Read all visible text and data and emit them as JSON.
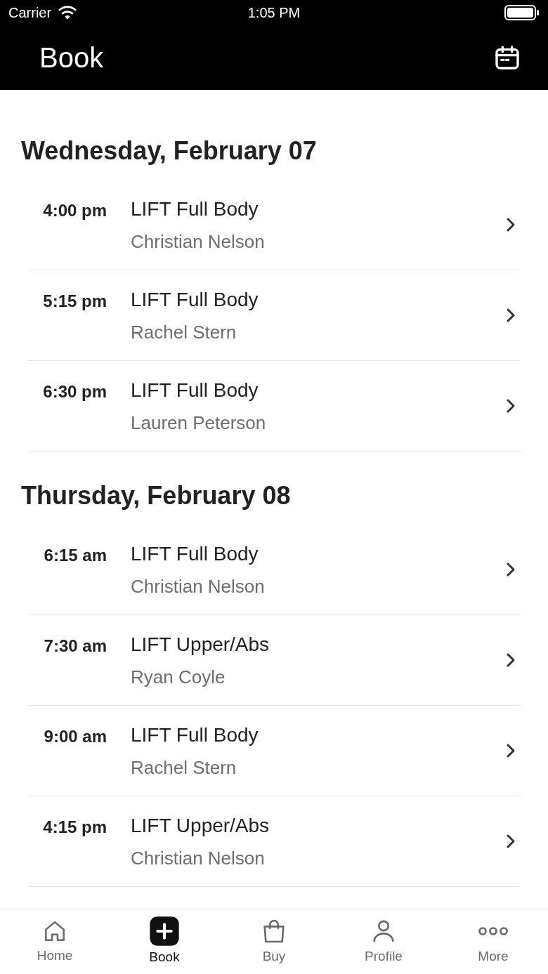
{
  "status_bar": {
    "carrier": "Carrier",
    "time": "1:05 PM"
  },
  "header": {
    "title": "Book"
  },
  "days": [
    {
      "heading": "Wednesday, February 07",
      "classes": [
        {
          "time": "4:00 pm",
          "name": "LIFT Full Body",
          "instructor": "Christian Nelson"
        },
        {
          "time": "5:15 pm",
          "name": "LIFT Full Body",
          "instructor": "Rachel Stern"
        },
        {
          "time": "6:30 pm",
          "name": "LIFT Full Body",
          "instructor": "Lauren Peterson"
        }
      ]
    },
    {
      "heading": "Thursday, February 08",
      "classes": [
        {
          "time": "6:15 am",
          "name": "LIFT Full Body",
          "instructor": "Christian Nelson"
        },
        {
          "time": "7:30 am",
          "name": "LIFT Upper/Abs",
          "instructor": "Ryan Coyle"
        },
        {
          "time": "9:00 am",
          "name": "LIFT Full Body",
          "instructor": "Rachel Stern"
        },
        {
          "time": "4:15 pm",
          "name": "LIFT Upper/Abs",
          "instructor": "Christian Nelson"
        }
      ]
    }
  ],
  "tab_bar": [
    {
      "kind": "home",
      "label": "Home",
      "selected": false
    },
    {
      "kind": "book",
      "label": "Book",
      "selected": true
    },
    {
      "kind": "buy",
      "label": "Buy",
      "selected": false
    },
    {
      "kind": "profile",
      "label": "Profile",
      "selected": false
    },
    {
      "kind": "more",
      "label": "More",
      "selected": false
    }
  ]
}
